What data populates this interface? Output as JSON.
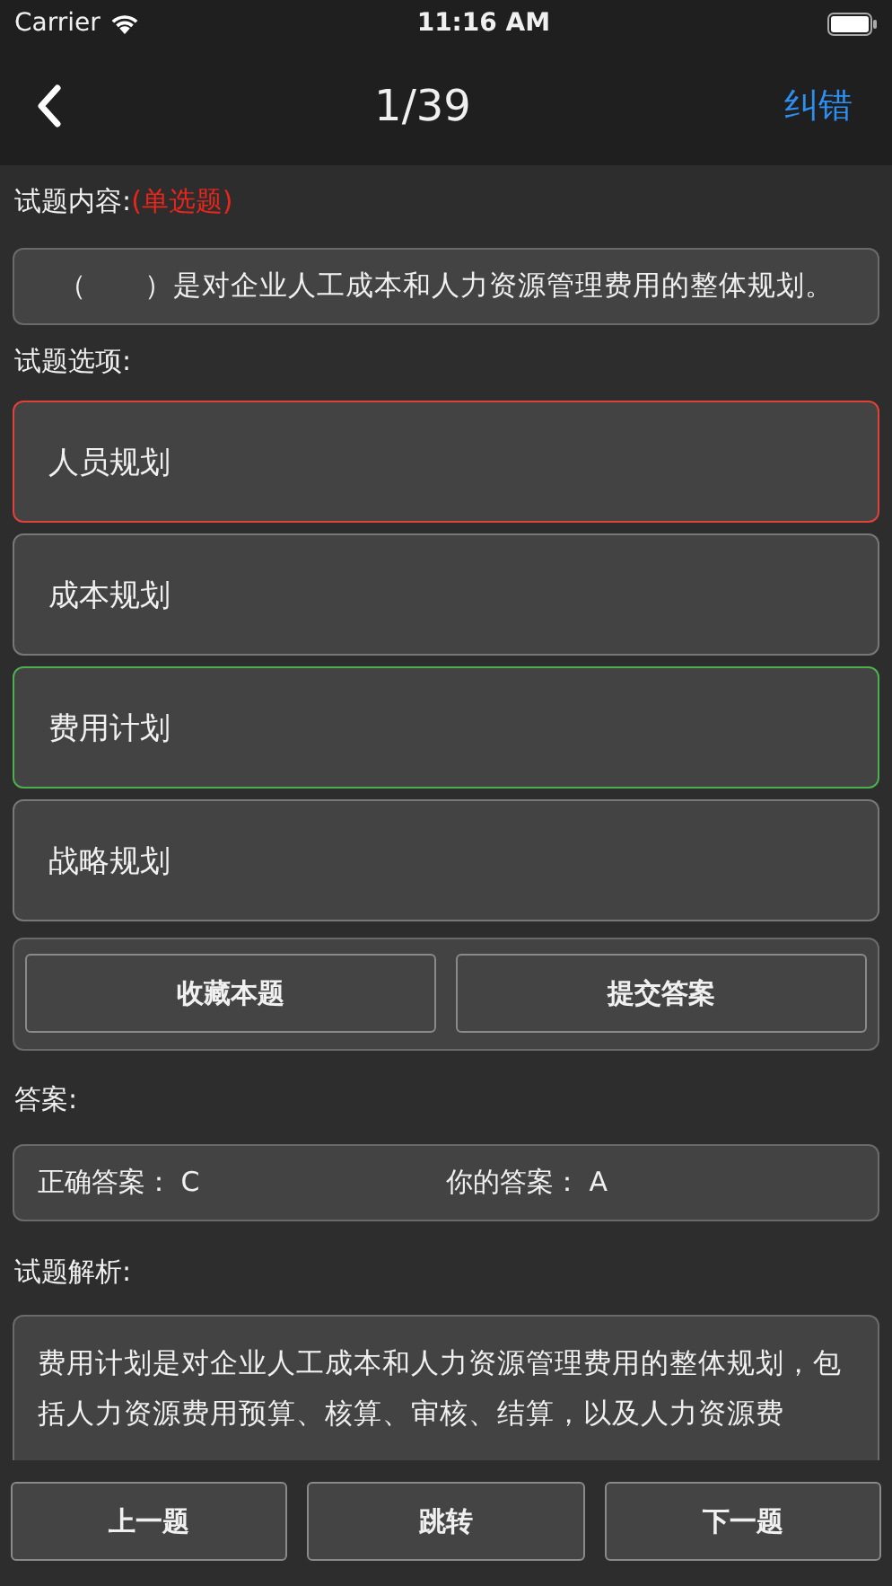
{
  "status_bar": {
    "carrier": "Carrier",
    "time": "11:16 AM"
  },
  "nav": {
    "title": "1/39",
    "action": "纠错"
  },
  "question": {
    "label": "试题内容:",
    "type": "(单选题)",
    "text": "（　　）是对企业人工成本和人力资源管理费用的整体规划。"
  },
  "options_label": "试题选项:",
  "options": [
    {
      "text": "人员规划",
      "selected": true,
      "correct": false
    },
    {
      "text": "成本规划",
      "selected": false,
      "correct": false
    },
    {
      "text": "费用计划",
      "selected": false,
      "correct": true
    },
    {
      "text": "战略规划",
      "selected": false,
      "correct": false
    }
  ],
  "actions": [
    "收藏本题",
    "提交答案"
  ],
  "answer": {
    "label": "答案:",
    "correct_label": "正确答案：",
    "correct": "C",
    "yours_label": "你的答案：",
    "yours": "A"
  },
  "analysis": {
    "label": "试题解析:",
    "text": "费用计划是对企业人工成本和人力资源管理费用的整体规划，包括人力资源费用预算、核算、审核、结算，以及人力资源费"
  },
  "footer": [
    "上一题",
    "跳转",
    "下一题"
  ]
}
